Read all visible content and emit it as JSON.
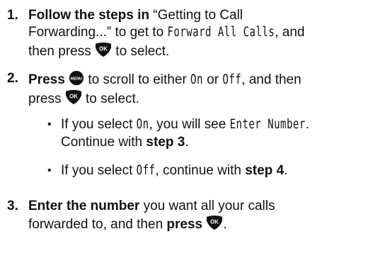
{
  "step1": {
    "number": "1.",
    "bold_a": "Follow the steps in",
    "quote": "“Getting to Call",
    "line2": "Forwarding...” to get to",
    "lcd": "Forward All Calls",
    "after_lcd": ", and",
    "line3_a": "then press",
    "line3_b": "to select."
  },
  "step2": {
    "number": "2.",
    "bold_a": "Press",
    "text_a": "to scroll to either",
    "lcd_on": "On",
    "or": "or",
    "lcd_off": "Off",
    "text_b": ", and then",
    "line2_a": "press",
    "line2_b": "to select."
  },
  "bullet1": {
    "text_a": "If you select",
    "lcd_on": "On",
    "text_b": ", you will see",
    "lcd_enter": "Enter Number",
    "text_c": ".",
    "line2_a": "Continue with",
    "line2_bold": "step 3",
    "line2_end": "."
  },
  "bullet2": {
    "text_a": "If you select",
    "lcd_off": "Off",
    "text_b": ", continue with",
    "bold": "step 4",
    "end": "."
  },
  "step3": {
    "number": "3.",
    "bold_a": "Enter the number",
    "text_a": "you want all your calls",
    "line2_a": "forwarded to, and then",
    "line2_bold": "press",
    "line2_end": "."
  },
  "icons": {
    "ok_label": "OK",
    "menu_label": "MENU"
  }
}
